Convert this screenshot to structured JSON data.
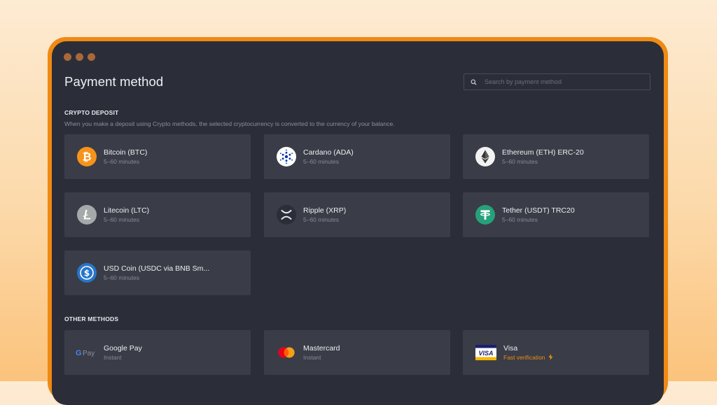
{
  "page": {
    "title": "Payment method"
  },
  "search": {
    "placeholder": "Search by payment method"
  },
  "crypto": {
    "heading": "CRYPTO DEPOSIT",
    "description": "When you make a deposit using Crypto methods, the selected cryptocurrency is converted to the currency of your balance.",
    "items": [
      {
        "name": "Bitcoin (BTC)",
        "sub": "5–60 minutes",
        "icon": "bitcoin-icon"
      },
      {
        "name": "Cardano (ADA)",
        "sub": "5–60 minutes",
        "icon": "cardano-icon"
      },
      {
        "name": "Ethereum (ETH) ERC-20",
        "sub": "5–60 minutes",
        "icon": "ethereum-icon"
      },
      {
        "name": "Litecoin (LTC)",
        "sub": "5–60 minutes",
        "icon": "litecoin-icon"
      },
      {
        "name": "Ripple (XRP)",
        "sub": "5–60 minutes",
        "icon": "ripple-icon"
      },
      {
        "name": "Tether (USDT) TRC20",
        "sub": "5–60 minutes",
        "icon": "tether-icon"
      },
      {
        "name": "USD Coin (USDC via BNB Sm...",
        "sub": "5–60 minutes",
        "icon": "usd-coin-icon"
      }
    ]
  },
  "other": {
    "heading": "OTHER METHODS",
    "items": [
      {
        "name": "Google Pay",
        "sub": "Instant",
        "icon": "google-pay-icon",
        "logo_text": "Pay"
      },
      {
        "name": "Mastercard",
        "sub": "Instant",
        "icon": "mastercard-icon"
      },
      {
        "name": "Visa",
        "sub": "Fast verification",
        "icon": "visa-icon",
        "logo_text": "VISA"
      }
    ]
  },
  "colors": {
    "accent": "#f08a13",
    "window": "#2b2e38",
    "card": "#3a3d47",
    "bitcoin": "#f7931a",
    "tether": "#26a17b",
    "usdc": "#2775ca"
  }
}
